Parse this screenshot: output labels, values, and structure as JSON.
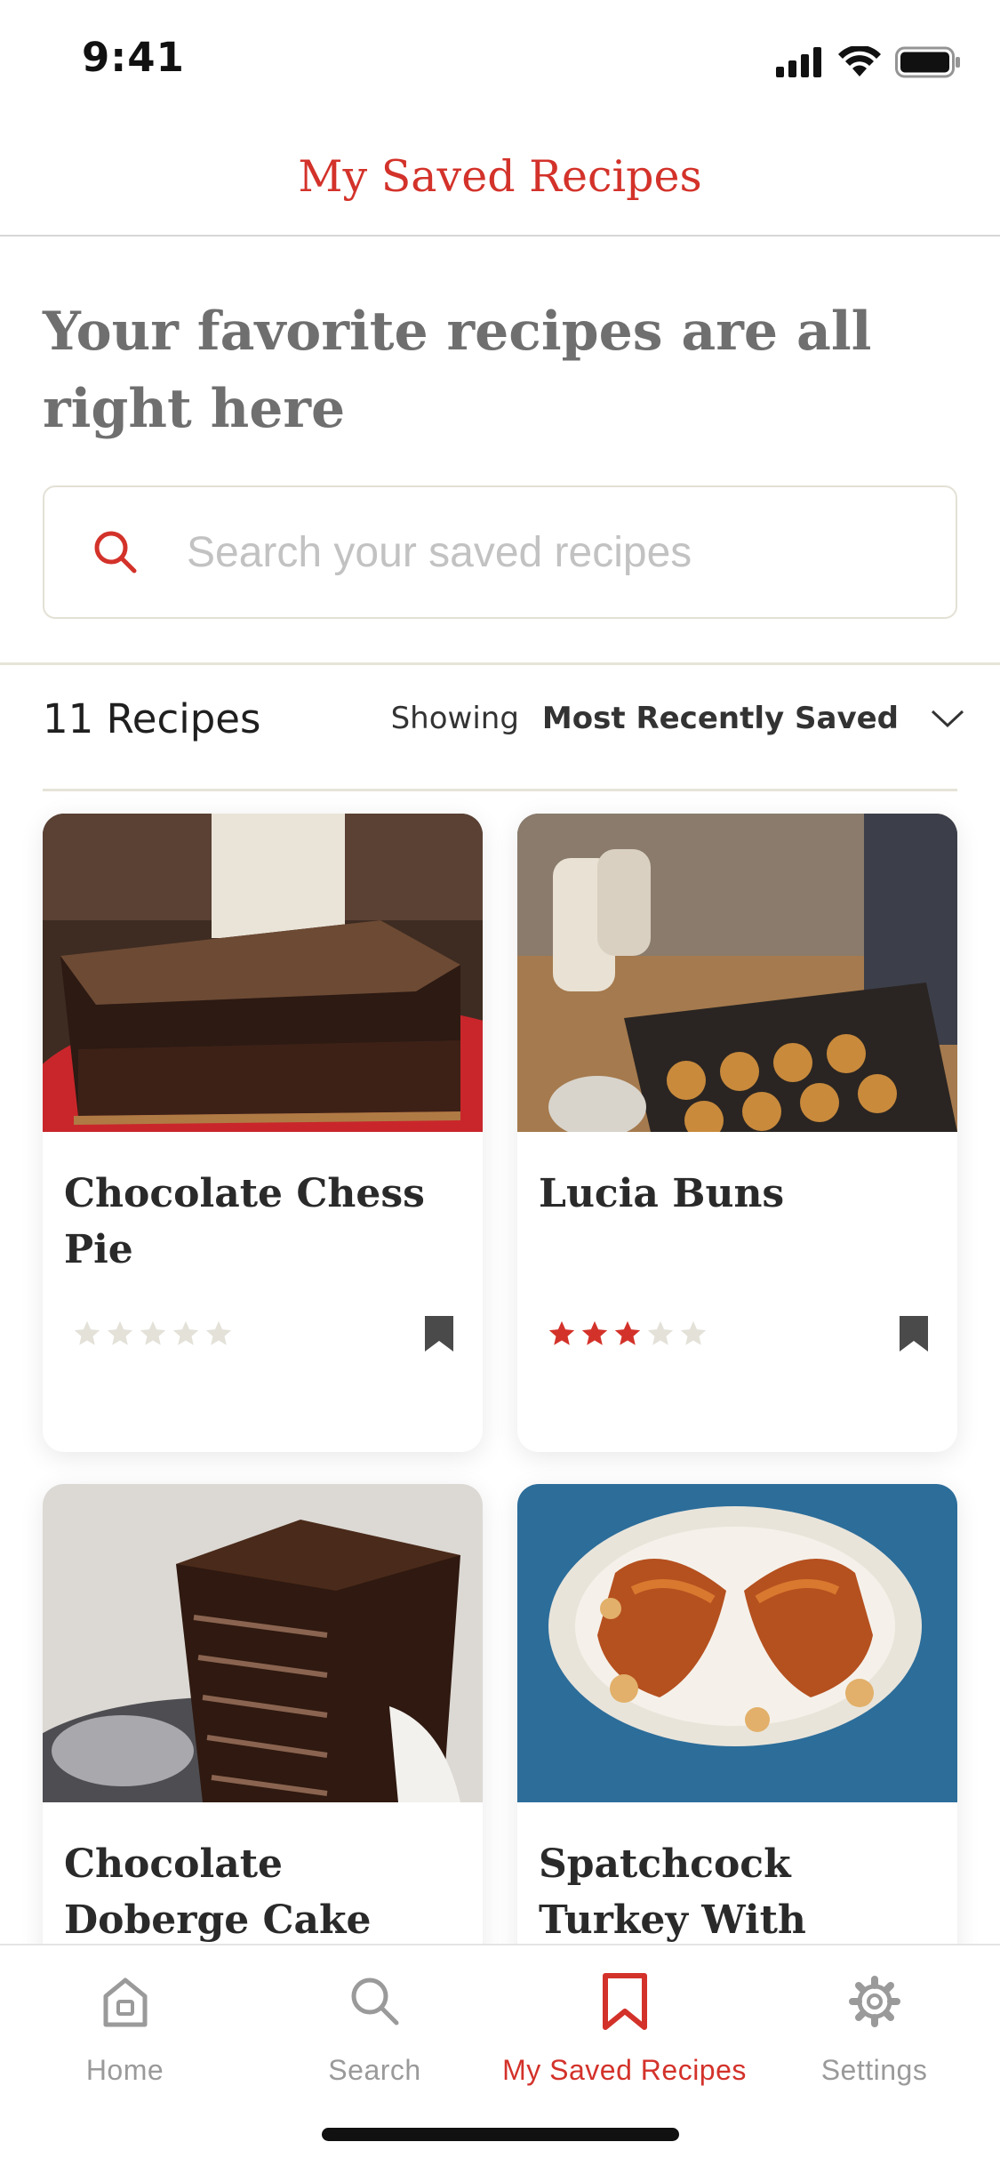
{
  "status_bar": {
    "time": "9:41"
  },
  "header": {
    "title": "My Saved Recipes"
  },
  "intro": {
    "heading": "Your favorite recipes are all right here"
  },
  "search": {
    "placeholder": "Search your saved recipes",
    "value": ""
  },
  "toolbar": {
    "count_label": "11 Recipes",
    "sort_prefix": "Showing",
    "sort_value": "Most Recently Saved"
  },
  "recipes": [
    {
      "title": "Chocolate Chess Pie",
      "rating": 0,
      "max_rating": 5,
      "saved": true,
      "image": "chocolate-pie-photo"
    },
    {
      "title": "Lucia Buns",
      "rating": 3,
      "max_rating": 5,
      "saved": true,
      "image": "lucia-buns-photo"
    },
    {
      "title": "Chocolate Doberge Cake",
      "rating": null,
      "max_rating": 5,
      "saved": true,
      "image": "doberge-cake-photo"
    },
    {
      "title": "Spatchcock Turkey With Anise and",
      "rating": null,
      "max_rating": 5,
      "saved": true,
      "image": "roast-turkey-photo"
    }
  ],
  "tab_bar": {
    "tabs": [
      {
        "label": "Home",
        "icon": "home-icon",
        "active": false
      },
      {
        "label": "Search",
        "icon": "search-icon",
        "active": false
      },
      {
        "label": "My Saved Recipes",
        "icon": "bookmark-icon",
        "active": true
      },
      {
        "label": "Settings",
        "icon": "gear-icon",
        "active": false
      }
    ]
  },
  "colors": {
    "accent": "#d3322a",
    "star_filled": "#d3322a",
    "star_empty": "#e3e1d8",
    "bookmark": "#4a4a4a",
    "tab_inactive": "#9a9a9a"
  }
}
